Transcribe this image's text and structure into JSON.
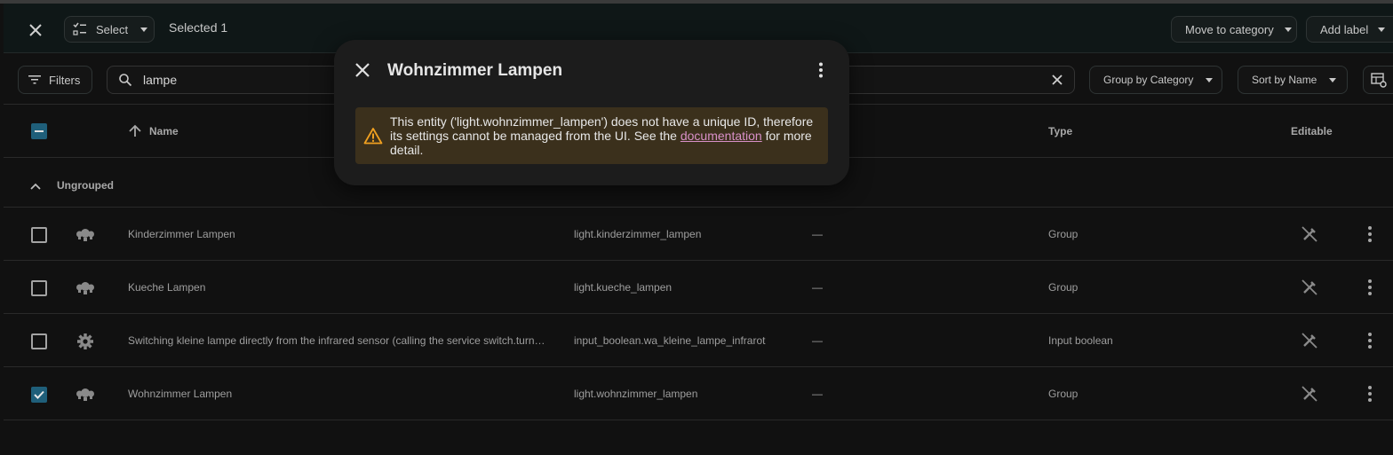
{
  "header": {
    "select_label": "Select",
    "selected_text": "Selected 1",
    "move_to_category": "Move to category",
    "add_label": "Add label"
  },
  "filters": {
    "filters_label": "Filters",
    "search_value": "lampe",
    "group_by": "Group by Category",
    "sort_by": "Sort by Name"
  },
  "table": {
    "columns": {
      "name": "Name",
      "type": "Type",
      "editable": "Editable"
    },
    "group_label": "Ungrouped",
    "rows": [
      {
        "name": "Kinderzimmer Lampen",
        "entity_id": "light.kinderzimmer_lampen",
        "area": "—",
        "type": "Group",
        "icon": "light-group-icon",
        "checked": false
      },
      {
        "name": "Kueche Lampen",
        "entity_id": "light.kueche_lampen",
        "area": "—",
        "type": "Group",
        "icon": "light-group-icon",
        "checked": false
      },
      {
        "name": "Switching kleine lampe directly from the infrared sensor (calling the service switch.turn_on)",
        "entity_id": "input_boolean.wa_kleine_lampe_infrarot",
        "area": "—",
        "type": "Input boolean",
        "icon": "gear-icon",
        "checked": false
      },
      {
        "name": "Wohnzimmer Lampen",
        "entity_id": "light.wohnzimmer_lampen",
        "area": "—",
        "type": "Group",
        "icon": "light-group-icon",
        "checked": true
      }
    ]
  },
  "dialog": {
    "title": "Wohnzimmer Lampen",
    "warning_before_link": "This entity ('light.wohnzimmer_lampen') does not have a unique ID, therefore its settings cannot be managed from the UI. See the ",
    "warning_link": "documentation",
    "warning_after_link": " for more detail."
  },
  "colors": {
    "accent": "#1f5f7a",
    "warning_bg": "#3b301c",
    "warning_icon": "#f0a020",
    "link": "#d890c8"
  }
}
